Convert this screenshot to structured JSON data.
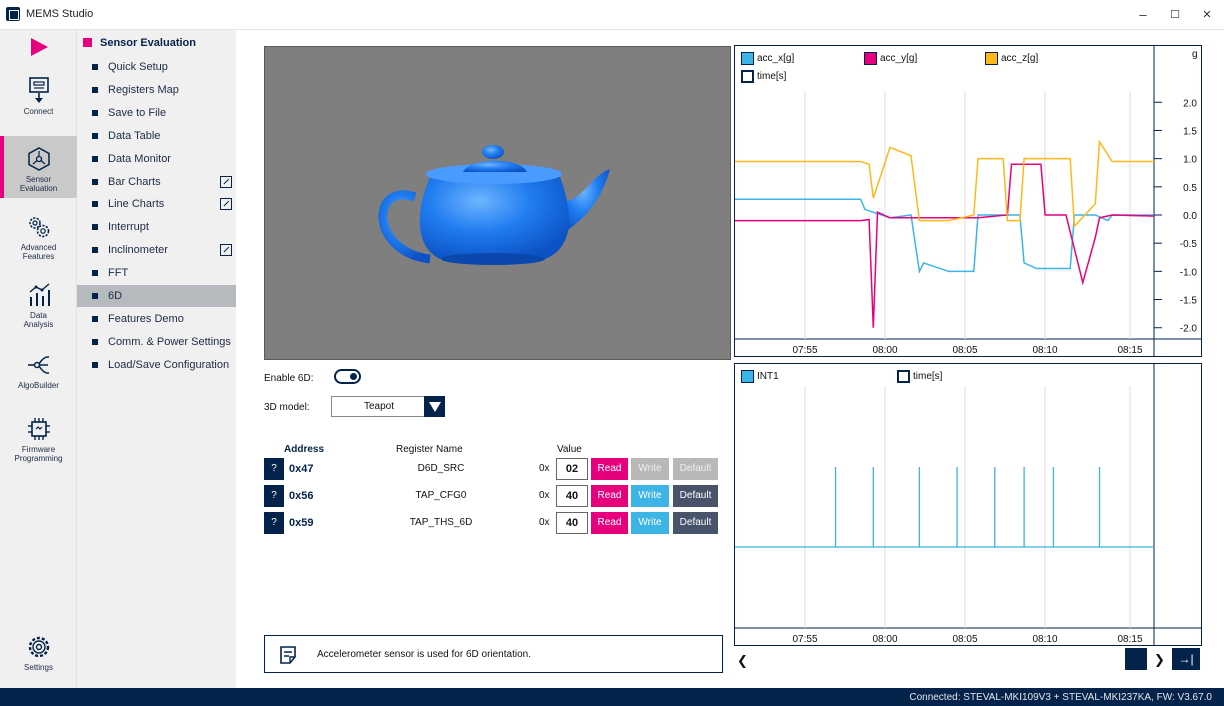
{
  "window": {
    "title": "MEMS Studio",
    "minimize": "–",
    "maximize": "☐",
    "close": "✕"
  },
  "iconbar": [
    {
      "name": "play",
      "label": ""
    },
    {
      "name": "connect",
      "label": "Connect"
    },
    {
      "name": "sensor-evaluation",
      "label1": "Sensor",
      "label2": "Evaluation"
    },
    {
      "name": "advanced-features",
      "label1": "Advanced",
      "label2": "Features"
    },
    {
      "name": "data-analysis",
      "label1": "Data",
      "label2": "Analysis"
    },
    {
      "name": "algobuilder",
      "label": "AlgoBuilder"
    },
    {
      "name": "firmware-programming",
      "label1": "Firmware",
      "label2": "Programming"
    },
    {
      "name": "settings",
      "label": "Settings"
    }
  ],
  "menu": {
    "header": "Sensor Evaluation",
    "items": [
      {
        "label": "Quick Setup"
      },
      {
        "label": "Registers Map"
      },
      {
        "label": "Save to File"
      },
      {
        "label": "Data Table"
      },
      {
        "label": "Data Monitor"
      },
      {
        "label": "Bar Charts",
        "external": true
      },
      {
        "label": "Line Charts",
        "external": true
      },
      {
        "label": "Interrupt"
      },
      {
        "label": "Inclinometer",
        "external": true
      },
      {
        "label": "FFT"
      },
      {
        "label": "6D",
        "active": true
      },
      {
        "label": "Features Demo"
      },
      {
        "label": "Comm. & Power Settings"
      },
      {
        "label": "Load/Save Configuration"
      }
    ]
  },
  "controls": {
    "enable_label": "Enable 6D:",
    "model_label": "3D model:",
    "model_value": "Teapot"
  },
  "registers": {
    "headers": {
      "address": "Address",
      "name": "Register Name",
      "value": "Value"
    },
    "prefix": "0x",
    "q": "?",
    "buttons": {
      "read": "Read",
      "write": "Write",
      "default": "Default"
    },
    "rows": [
      {
        "address": "0x47",
        "name": "D6D_SRC",
        "value": "02",
        "disabled": true
      },
      {
        "address": "0x56",
        "name": "TAP_CFG0",
        "value": "40",
        "disabled": false
      },
      {
        "address": "0x59",
        "name": "TAP_THS_6D",
        "value": "40",
        "disabled": false
      }
    ]
  },
  "info": {
    "text": "Accelerometer sensor is used for 6D orientation."
  },
  "colors": {
    "acc_x": "#3cb4e6",
    "acc_y": "#e6007e",
    "acc_z": "#ffb81c",
    "navy": "#03234b"
  },
  "chart_data": [
    {
      "type": "line",
      "unit_label": "g",
      "xlabel": "time[s]",
      "x_ticks": [
        "07:55",
        "08:00",
        "08:05",
        "08:10",
        "08:15"
      ],
      "y_ticks": [
        "2.0",
        "1.5",
        "1.0",
        "0.5",
        "0.0",
        "-0.5",
        "-1.0",
        "-1.5",
        "-2.0"
      ],
      "ylim": [
        -2.2,
        2.2
      ],
      "xlim": [
        0,
        100
      ],
      "series": [
        {
          "name": "acc_x[g]",
          "color": "#3cb4e6",
          "x": [
            0,
            30,
            31,
            33,
            37,
            42,
            44,
            45,
            51,
            57,
            58,
            68,
            69,
            72,
            80,
            81,
            86,
            89,
            90,
            97,
            100
          ],
          "y": [
            0.28,
            0.28,
            0.1,
            0.05,
            -0.05,
            0.0,
            -1.0,
            -0.85,
            -1.0,
            -1.0,
            0.0,
            0.0,
            -0.85,
            -0.95,
            -0.95,
            0.0,
            0.0,
            -0.1,
            0.0,
            0.0,
            0.0
          ]
        },
        {
          "name": "acc_y[g]",
          "color": "#e6007e",
          "x": [
            0,
            30,
            32,
            33,
            34,
            37,
            45,
            58,
            65,
            66,
            73,
            74,
            79,
            80,
            83,
            86,
            87,
            90,
            100
          ],
          "y": [
            -0.1,
            -0.1,
            -0.08,
            -2.0,
            0.05,
            -0.05,
            -0.05,
            -0.05,
            0.0,
            0.9,
            0.9,
            0.0,
            0.0,
            -0.3,
            -1.2,
            -0.4,
            -0.05,
            0.0,
            -0.02
          ]
        },
        {
          "name": "acc_z[g]",
          "color": "#ffb81c",
          "x": [
            0,
            30,
            32,
            33,
            37,
            42,
            44,
            51,
            57,
            58,
            64,
            65,
            68,
            69,
            72,
            80,
            81,
            86,
            87,
            90,
            100
          ],
          "y": [
            0.95,
            0.95,
            0.9,
            0.3,
            1.2,
            1.05,
            -0.1,
            -0.1,
            0.0,
            1.0,
            1.0,
            -0.1,
            -0.1,
            1.0,
            1.0,
            1.0,
            -0.2,
            0.2,
            1.3,
            0.95,
            0.95
          ]
        }
      ]
    },
    {
      "type": "line",
      "xlabel": "time[s]",
      "x_ticks": [
        "07:55",
        "08:00",
        "08:05",
        "08:10",
        "08:15"
      ],
      "xlim": [
        0,
        100
      ],
      "series": [
        {
          "name": "INT1",
          "color": "#3cb4e6",
          "pulses": [
            24,
            33,
            44,
            53,
            62,
            69,
            76,
            87
          ]
        }
      ]
    }
  ],
  "status": {
    "text": "Connected:  STEVAL-MKI109V3 + STEVAL-MKI237KA, FW: V3.67.0"
  }
}
